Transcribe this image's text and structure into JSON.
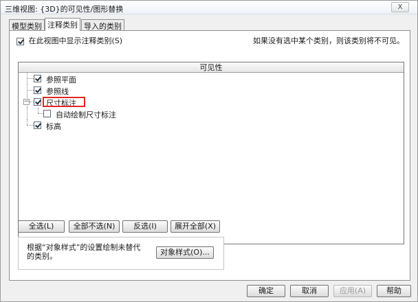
{
  "window": {
    "title": "三维视图: {3D}的可见性/图形替换",
    "close_label": "X"
  },
  "tabs": [
    {
      "label": "模型类别",
      "active": false
    },
    {
      "label": "注释类别",
      "active": true
    },
    {
      "label": "导入的类别",
      "active": false
    }
  ],
  "panel": {
    "show_categories_label": "在此视图中显示注释类别(S)",
    "show_categories_checked": true,
    "hint": "如果没有选中某个类别，则该类别将不可见。",
    "visibility_header": "可见性",
    "tree": [
      {
        "label": "参照平面",
        "checked": true,
        "level": 0
      },
      {
        "label": "参照线",
        "checked": true,
        "level": 0
      },
      {
        "label": "尺寸标注",
        "checked": true,
        "level": 0,
        "expanded": true,
        "highlighted": true
      },
      {
        "label": "自动绘制尺寸标注",
        "checked": false,
        "level": 1
      },
      {
        "label": "标高",
        "checked": true,
        "level": 0
      }
    ],
    "buttons": {
      "select_all": "全选(L)",
      "select_none": "全部不选(N)",
      "invert": "反选(I)",
      "expand_all": "展开全部(X)"
    },
    "object_styles": {
      "description": "根据“对象样式”的设置绘制未替代的类别。",
      "button": "对象样式(O)..."
    }
  },
  "footer": {
    "ok": "确定",
    "cancel": "取消",
    "apply": "应用(A)",
    "help": "帮助"
  }
}
